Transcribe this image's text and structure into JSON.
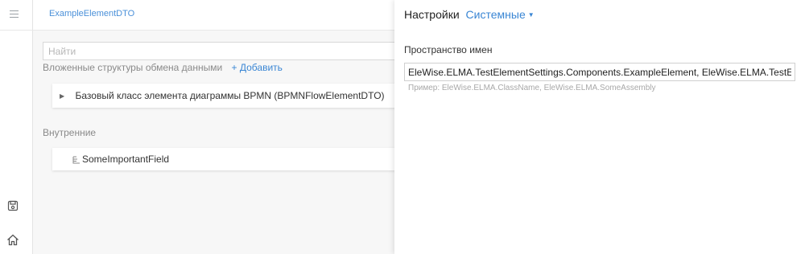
{
  "header": {
    "title": "ExampleElementDTO"
  },
  "main": {
    "search_placeholder": "Найти",
    "nested_label": "Вложенные структуры обмена данными",
    "add_label": "+ Добавить",
    "base_class_item": "Базовый класс элемента диаграммы BPMN (BPMNFlowElementDTO)",
    "internal_section": "Внутренние",
    "internal_fields": [
      "SomeImportantField"
    ]
  },
  "panel": {
    "title": "Настройки",
    "dropdown": "Системные",
    "namespace_label": "Пространство имен",
    "namespace_value": "EleWise.ELMA.TestElementSettings.Components.ExampleElement, EleWise.ELMA.TestElementSettings",
    "namespace_hint": "Пример: EleWise.ELMA.ClassName, EleWise.ELMA.SomeAssembly"
  },
  "icons": {
    "menu": "hamburger-menu-icon",
    "save": "save-icon",
    "home": "home-icon",
    "field": "field-icon",
    "caret": "caret-right-icon",
    "dropdown_arrow": "caret-down-icon"
  },
  "colors": {
    "accent": "#3a86d4",
    "title_link": "#4a90d9",
    "muted_text": "#8a8a8a"
  }
}
